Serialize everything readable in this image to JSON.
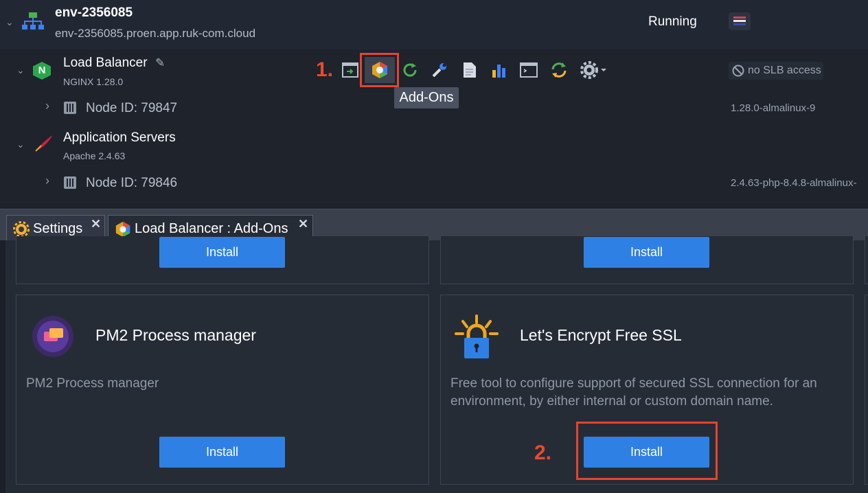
{
  "environment": {
    "name": "env-2356085",
    "domain": "env-2356085.proen.app.ruk-com.cloud",
    "status": "Running"
  },
  "layers": [
    {
      "name": "Load Balancer",
      "version": "NGINX 1.28.0",
      "node_label": "Node ID: 79847",
      "node_tag": "1.28.0-almalinux-9",
      "access": "no SLB access"
    },
    {
      "name": "Application Servers",
      "version": "Apache 2.4.63",
      "node_label": "Node ID: 79846",
      "node_tag": "2.4.63-php-8.4.8-almalinux-"
    }
  ],
  "annotations": {
    "step1": "1.",
    "step2": "2."
  },
  "toolbar": {
    "icons": [
      "open-in-browser-icon",
      "addons-icon",
      "restart-icon",
      "config-icon",
      "log-icon",
      "statistics-icon",
      "web-ssh-icon",
      "redeploy-icon",
      "settings-gear-icon"
    ],
    "tooltip": "Add-Ons"
  },
  "tabs": [
    {
      "label": "Settings",
      "icon": "settings-icon"
    },
    {
      "label": "Load Balancer : Add-Ons",
      "icon": "addons-icon"
    }
  ],
  "addons": {
    "install_label": "Install",
    "pm2": {
      "title": "PM2 Process manager",
      "description": "PM2 Process manager"
    },
    "letsencrypt": {
      "title": "Let's Encrypt Free SSL",
      "description_line1": "Free tool to configure support of secured SSL connection for an",
      "description_line2": "environment, by either internal or custom domain name."
    }
  },
  "colors": {
    "accent": "#2f80e4",
    "highlight": "#e8432d",
    "running": "#ffffff"
  }
}
